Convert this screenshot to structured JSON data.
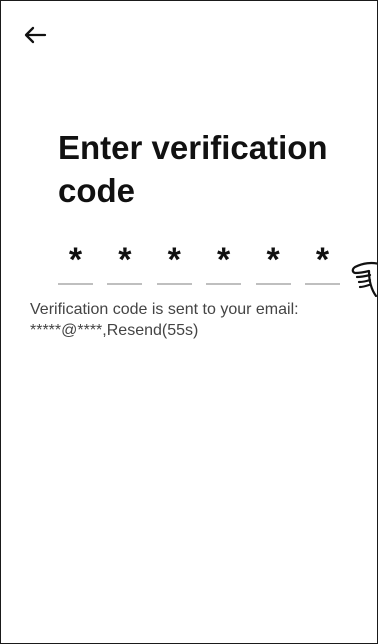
{
  "header": {
    "back_icon": "arrow-left-icon"
  },
  "content": {
    "title": "Enter verification code",
    "code_digits": [
      "*",
      "*",
      "*",
      "*",
      "*",
      "*"
    ],
    "info_message": "Verification code is sent to your email:",
    "masked_email": "*****@****",
    "separator": ",",
    "resend_label": "Resend(55s)",
    "gesture_icon": "pointing-hand-icon"
  },
  "colors": {
    "background": "#ffffff",
    "text": "#111111",
    "secondary_text": "#444444",
    "underline": "#bfbfbf"
  }
}
